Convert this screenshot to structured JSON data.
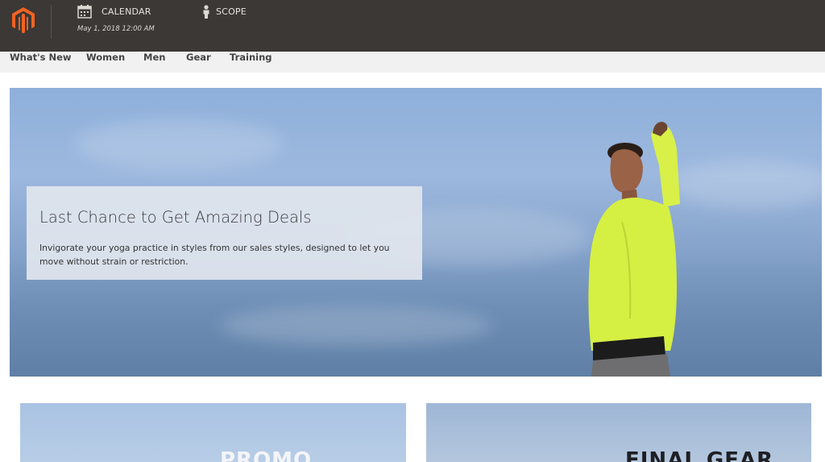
{
  "admin_bar": {
    "calendar_label": "CALENDAR",
    "calendar_date": "May 1, 2018 12:00 AM",
    "scope_label": "SCOPE",
    "icons": [
      "magento-logo-icon",
      "calendar-icon",
      "person-icon"
    ],
    "colors": {
      "background": "#3b3835",
      "logo": "#f26322"
    }
  },
  "nav": {
    "items": [
      "What's New",
      "Women",
      "Men",
      "Gear",
      "Training"
    ]
  },
  "hero": {
    "title": "Last Chance to Get Amazing Deals",
    "text": "Invigorate your yoga practice in styles from our sales styles, designed to let you move without strain or restriction."
  },
  "tiles": [
    {
      "title": "PROMO"
    },
    {
      "title": "FINAL GEAR"
    }
  ]
}
